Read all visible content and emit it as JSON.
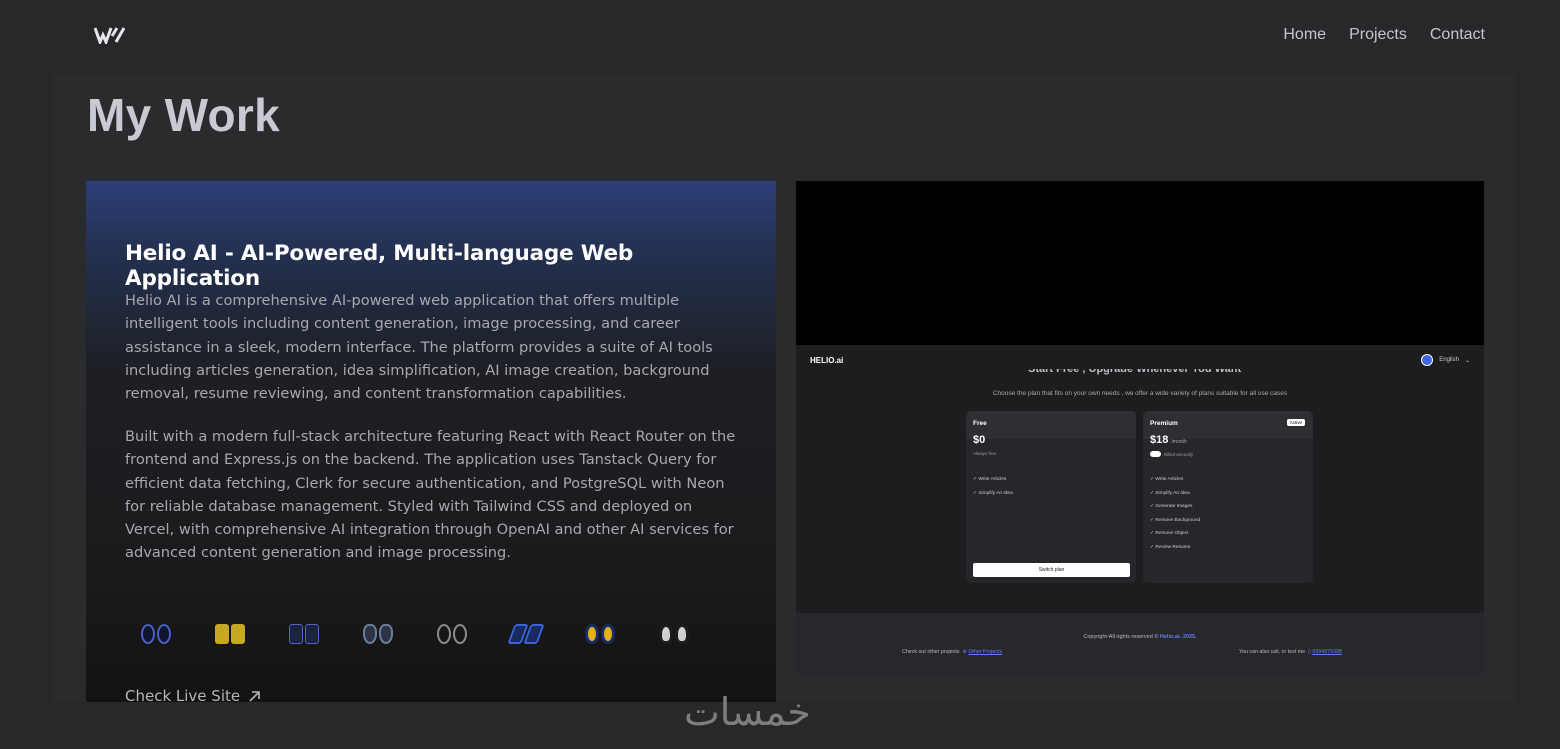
{
  "header": {
    "logo_icon": "brand-logo-icon",
    "nav": [
      "Home",
      "Projects",
      "Contact"
    ]
  },
  "page": {
    "title": "My Work"
  },
  "project": {
    "title": "Helio AI - AI-Powered, Multi-language Web Application",
    "description_1": "Helio AI is a comprehensive AI-powered web application that offers multiple intelligent tools including content generation, image processing, and career assistance in a sleek, modern interface. The platform provides a suite of AI tools including articles generation, idea simplification, AI image creation, background removal, resume reviewing, and content transformation capabilities.",
    "description_2": "Built with a modern full-stack architecture featuring React with React Router on the frontend and Express.js on the backend. The application uses Tanstack Query for efficient data fetching, Clerk for secure authentication, and PostgreSQL with Neon for reliable database management. Styled with Tailwind CSS and deployed on Vercel, with comprehensive AI integration through OpenAI and other AI services for advanced content generation and image processing.",
    "tech_icons": [
      "react-icon",
      "javascript-icon",
      "express-icon",
      "postgresql-icon",
      "openai-icon",
      "tailwind-icon",
      "clerk-icon",
      "neon-icon"
    ],
    "live_label": "Check Live Site"
  },
  "screenshot": {
    "logo": "HELIO.ai",
    "language": "English",
    "hero_cut": "Start Free , Upgrade Whenever You Want",
    "subtitle": "Choose the plan that fits on your own needs , we offer a wide variety of plans suitable for all use cases",
    "free": {
      "name": "Free",
      "price": "$0",
      "note": "Always free",
      "features": [
        "Write Articles",
        "Simplify An Idea"
      ],
      "button": "Switch plan"
    },
    "premium": {
      "name": "Premium",
      "price": "$18",
      "per": "/month",
      "badge": "Active",
      "note": "Billed annually",
      "features": [
        "Write Articles",
        "Simplify An Idea",
        "Generate Images",
        "Remove Background",
        "Remove Object",
        "Review Resume"
      ]
    },
    "copyright": "Copyright-All rights reserved ©",
    "copyright_brand": "Helio.ai- 2025.",
    "other_text": "Check out other projects",
    "other_link": "Other Projects",
    "contact_text": "You can also call, or text me",
    "phone": "0994875398"
  },
  "watermark": "خمسات"
}
